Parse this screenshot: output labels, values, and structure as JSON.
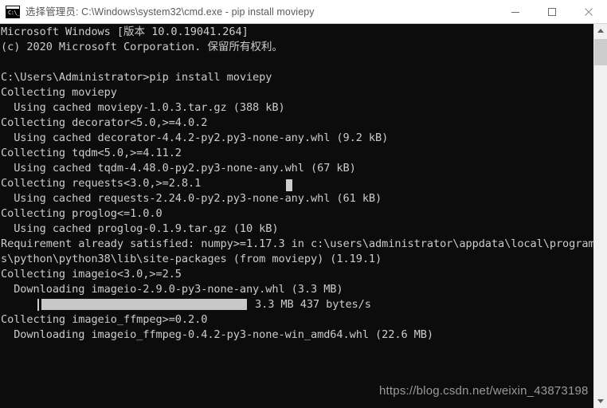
{
  "window": {
    "title": "选择管理员: C:\\Windows\\system32\\cmd.exe - pip  install moviepy",
    "icon_name": "cmd-icon",
    "icon_glyph": "C:\\_",
    "controls": {
      "minimize": "minimize-button",
      "maximize": "maximize-button",
      "close": "close-button"
    },
    "titlebar_bg": "#ffffff",
    "titlebar_text_color": "#5a5a5a"
  },
  "terminal": {
    "background": "#0c0c0c",
    "foreground": "#cccccc",
    "lines": [
      "Microsoft Windows [版本 10.0.19041.264]",
      "(c) 2020 Microsoft Corporation. 保留所有权利。",
      "",
      "C:\\Users\\Administrator>pip install moviepy",
      "Collecting moviepy",
      "  Using cached moviepy-1.0.3.tar.gz (388 kB)",
      "Collecting decorator<5.0,>=4.0.2",
      "  Using cached decorator-4.4.2-py2.py3-none-any.whl (9.2 kB)",
      "Collecting tqdm<5.0,>=4.11.2",
      "  Using cached tqdm-4.48.0-py2.py3-none-any.whl (67 kB)",
      "Collecting requests<3.0,>=2.8.1",
      "  Using cached requests-2.24.0-py2.py3-none-any.whl (61 kB)",
      "Collecting proglog<=1.0.0",
      "  Using cached proglog-0.1.9.tar.gz (10 kB)",
      "Requirement already satisfied: numpy>=1.17.3 in c:\\users\\administrator\\appdata\\local\\program",
      "s\\python\\python38\\lib\\site-packages (from moviepy) (1.19.1)",
      "Collecting imageio<3.0,>=2.5",
      "  Downloading imageio-2.9.0-py3-none-any.whl (3.3 MB)"
    ],
    "progress": {
      "status_text": "3.3 MB 437 bytes/s",
      "fill_color": "#c8c8c8",
      "percent": 100
    },
    "lines_after_progress": [
      "Collecting imageio_ffmpeg>=0.2.0",
      "  Downloading imageio_ffmpeg-0.4.2-py3-none-win_amd64.whl (22.6 MB)"
    ],
    "cursor_visible": true
  },
  "watermark": {
    "text": "https://blog.csdn.net/weixin_43873198"
  },
  "scrollbar": {
    "up_arrow": "scroll-up-arrow",
    "down_arrow": "scroll-down-arrow",
    "thumb": "scroll-thumb",
    "thumb_color": "#cdcdcd",
    "track_color": "#f0f0f0"
  }
}
